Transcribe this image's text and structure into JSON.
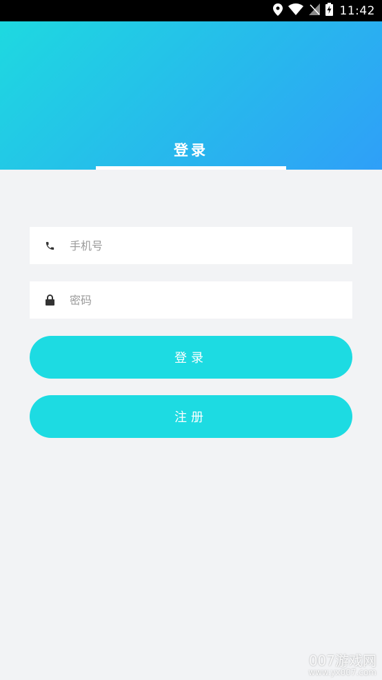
{
  "status_bar": {
    "time": "11:42",
    "icons": [
      "location-icon",
      "wifi-icon",
      "no-signal-icon",
      "battery-charging-icon"
    ]
  },
  "header": {
    "title": "登录",
    "gradient_start": "#1ed9e0",
    "gradient_end": "#2f9ff8"
  },
  "form": {
    "phone": {
      "icon": "phone-icon",
      "placeholder": "手机号",
      "value": ""
    },
    "password": {
      "icon": "lock-icon",
      "placeholder": "密码",
      "value": ""
    }
  },
  "buttons": {
    "login_label": "登录",
    "register_label": "注册",
    "color": "#1ddbe2"
  },
  "watermark": {
    "text": "007游戏网",
    "url": "www.yx007.com"
  }
}
